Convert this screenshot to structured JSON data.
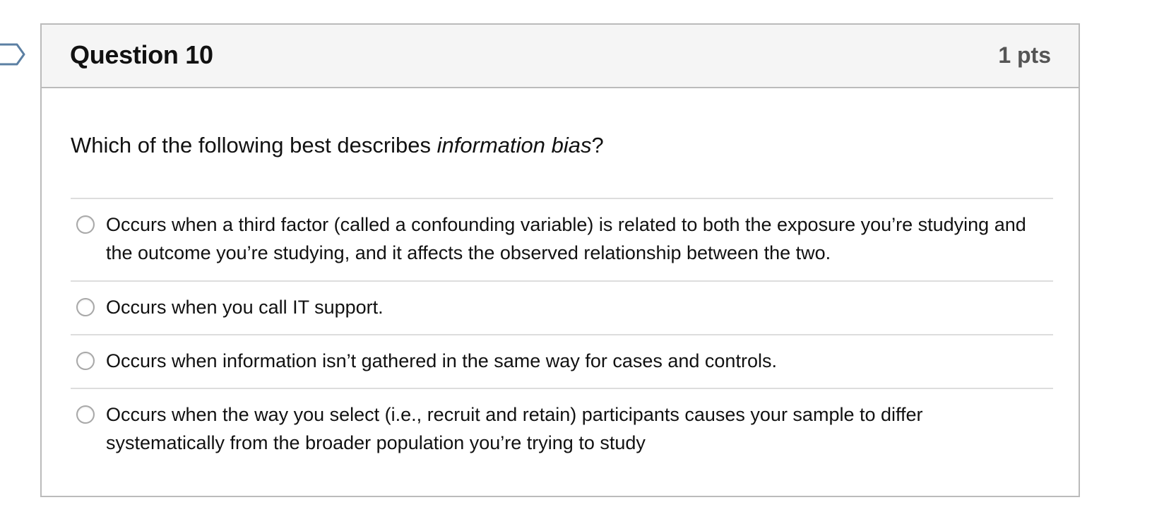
{
  "question": {
    "title": "Question 10",
    "points": "1 pts",
    "prompt_prefix": "Which of the following best describes ",
    "prompt_emphasis": "information bias",
    "prompt_suffix": "?"
  },
  "answers": [
    {
      "text": "Occurs when a third factor (called a confounding variable) is related to both the exposure you’re studying and the outcome you’re studying, and it affects the observed relationship between the two.",
      "selected": false
    },
    {
      "text": "Occurs when you call IT support.",
      "selected": false
    },
    {
      "text": "Occurs when information isn’t gathered in the same way for cases and controls.",
      "selected": false
    },
    {
      "text": "Occurs when the way you select (i.e., recruit and retain) participants causes your sample to differ systematically from the broader population you’re trying to study",
      "selected": false
    }
  ],
  "icons": {
    "flag": "flag-question-icon"
  },
  "colors": {
    "header_bg": "#f5f5f5",
    "border": "#bbbbbb",
    "divider": "#dddddd",
    "flag_stroke": "#5b7fa3",
    "points_text": "#555555"
  }
}
